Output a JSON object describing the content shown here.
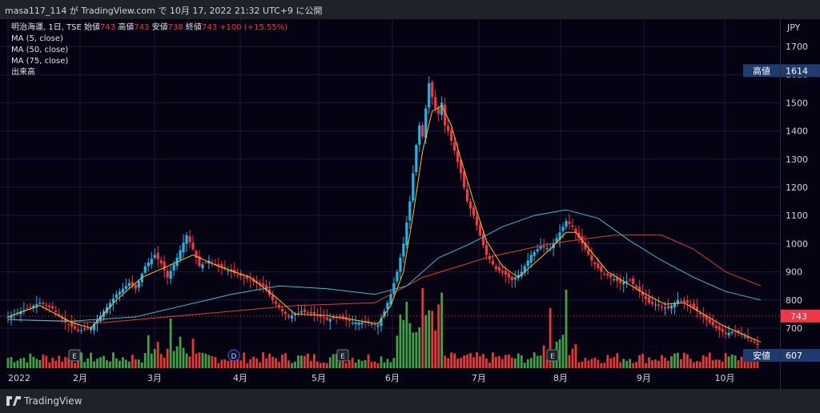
{
  "header": {
    "publish_line": "masa117_114 が TradingView.com で 10月 17, 2022 21:32 UTC+9 に公開"
  },
  "legend": {
    "symbol": "明治海運, 1日, TSE",
    "open_label": "始値",
    "open_value": "743",
    "high_label": "高値",
    "high_value": "743",
    "low_label": "安値",
    "low_value": "738",
    "close_label": "終値",
    "close_value": "743",
    "change": "+100 (+15.55%)",
    "ma5": "MA (5, close)",
    "ma50": "MA (50, close)",
    "ma75": "MA (75, close)",
    "volume": "出来高"
  },
  "footer": {
    "brand": "TradingView"
  },
  "colors": {
    "up": "#26a69a",
    "up_candle": "#22b5e6",
    "down": "#f23645",
    "ma5": "#f5c518",
    "ma50": "#2ec4d6",
    "ma75": "#e53935",
    "vol_up": "#43a047",
    "vol_down": "#e53935"
  },
  "chart_data": {
    "type": "candlestick",
    "currency": "JPY",
    "ylim": [
      600,
      1750
    ],
    "y_ticks": [
      "1700",
      "1600",
      "1500",
      "1400",
      "1300",
      "1200",
      "1100",
      "1000",
      "900",
      "800",
      "700"
    ],
    "x_ticks": [
      "2022",
      "2月",
      "3月",
      "4月",
      "5月",
      "6月",
      "7月",
      "8月",
      "9月",
      "10月"
    ],
    "markers": [
      "E",
      "D",
      "E",
      "E"
    ],
    "high_label": "高値",
    "high_value": "1614",
    "low_label": "安値",
    "low_value": "607",
    "last_price": "743",
    "price_path": [
      [
        0,
        740
      ],
      [
        6,
        770
      ],
      [
        10,
        790
      ],
      [
        14,
        770
      ],
      [
        18,
        720
      ],
      [
        22,
        690
      ],
      [
        26,
        700
      ],
      [
        30,
        760
      ],
      [
        34,
        820
      ],
      [
        38,
        860
      ],
      [
        40,
        840
      ],
      [
        43,
        920
      ],
      [
        46,
        960
      ],
      [
        48,
        930
      ],
      [
        50,
        880
      ],
      [
        53,
        950
      ],
      [
        56,
        1030
      ],
      [
        58,
        980
      ],
      [
        60,
        920
      ],
      [
        63,
        940
      ],
      [
        66,
        920
      ],
      [
        70,
        900
      ],
      [
        74,
        880
      ],
      [
        78,
        860
      ],
      [
        80,
        850
      ],
      [
        83,
        800
      ],
      [
        86,
        760
      ],
      [
        88,
        740
      ],
      [
        92,
        760
      ],
      [
        96,
        750
      ],
      [
        100,
        730
      ],
      [
        104,
        740
      ],
      [
        108,
        720
      ],
      [
        112,
        720
      ],
      [
        116,
        710
      ],
      [
        118,
        760
      ],
      [
        120,
        820
      ],
      [
        122,
        900
      ],
      [
        124,
        1000
      ],
      [
        126,
        1150
      ],
      [
        127,
        1250
      ],
      [
        128,
        1350
      ],
      [
        129,
        1420
      ],
      [
        130,
        1380
      ],
      [
        131,
        1480
      ],
      [
        132,
        1570
      ],
      [
        133,
        1520
      ],
      [
        134,
        1480
      ],
      [
        135,
        1460
      ],
      [
        136,
        1500
      ],
      [
        137,
        1420
      ],
      [
        138,
        1400
      ],
      [
        140,
        1330
      ],
      [
        142,
        1250
      ],
      [
        144,
        1150
      ],
      [
        146,
        1100
      ],
      [
        148,
        1030
      ],
      [
        150,
        960
      ],
      [
        153,
        910
      ],
      [
        156,
        890
      ],
      [
        158,
        870
      ],
      [
        161,
        900
      ],
      [
        164,
        960
      ],
      [
        167,
        990
      ],
      [
        170,
        980
      ],
      [
        173,
        1040
      ],
      [
        175,
        1080
      ],
      [
        177,
        1060
      ],
      [
        180,
        1000
      ],
      [
        183,
        940
      ],
      [
        186,
        900
      ],
      [
        189,
        880
      ],
      [
        192,
        860
      ],
      [
        195,
        870
      ],
      [
        198,
        830
      ],
      [
        201,
        790
      ],
      [
        204,
        780
      ],
      [
        207,
        770
      ],
      [
        210,
        800
      ],
      [
        213,
        790
      ],
      [
        216,
        760
      ],
      [
        219,
        730
      ],
      [
        222,
        700
      ],
      [
        225,
        680
      ],
      [
        228,
        690
      ],
      [
        231,
        670
      ],
      [
        234,
        650
      ],
      [
        235,
        640
      ],
      [
        236,
        743
      ]
    ],
    "ma5": [
      [
        0,
        740
      ],
      [
        10,
        780
      ],
      [
        20,
        720
      ],
      [
        26,
        700
      ],
      [
        34,
        800
      ],
      [
        42,
        880
      ],
      [
        50,
        920
      ],
      [
        58,
        960
      ],
      [
        66,
        920
      ],
      [
        76,
        880
      ],
      [
        84,
        810
      ],
      [
        90,
        750
      ],
      [
        100,
        745
      ],
      [
        108,
        730
      ],
      [
        116,
        715
      ],
      [
        120,
        780
      ],
      [
        124,
        900
      ],
      [
        127,
        1100
      ],
      [
        130,
        1330
      ],
      [
        133,
        1470
      ],
      [
        136,
        1490
      ],
      [
        139,
        1420
      ],
      [
        142,
        1300
      ],
      [
        146,
        1150
      ],
      [
        150,
        1010
      ],
      [
        155,
        920
      ],
      [
        160,
        880
      ],
      [
        164,
        920
      ],
      [
        170,
        980
      ],
      [
        175,
        1040
      ],
      [
        178,
        1040
      ],
      [
        183,
        970
      ],
      [
        188,
        900
      ],
      [
        194,
        860
      ],
      [
        200,
        820
      ],
      [
        206,
        785
      ],
      [
        212,
        790
      ],
      [
        218,
        750
      ],
      [
        224,
        710
      ],
      [
        230,
        680
      ],
      [
        236,
        650
      ]
    ],
    "ma50": [
      [
        0,
        730
      ],
      [
        20,
        725
      ],
      [
        40,
        740
      ],
      [
        55,
        780
      ],
      [
        70,
        820
      ],
      [
        85,
        850
      ],
      [
        100,
        840
      ],
      [
        115,
        820
      ],
      [
        125,
        850
      ],
      [
        135,
        950
      ],
      [
        145,
        1000
      ],
      [
        155,
        1060
      ],
      [
        165,
        1100
      ],
      [
        175,
        1120
      ],
      [
        185,
        1090
      ],
      [
        195,
        1010
      ],
      [
        205,
        940
      ],
      [
        215,
        880
      ],
      [
        225,
        830
      ],
      [
        236,
        800
      ]
    ],
    "ma75": [
      [
        0,
        730
      ],
      [
        30,
        720
      ],
      [
        60,
        750
      ],
      [
        90,
        780
      ],
      [
        115,
        790
      ],
      [
        130,
        880
      ],
      [
        150,
        950
      ],
      [
        170,
        1000
      ],
      [
        190,
        1030
      ],
      [
        205,
        1030
      ],
      [
        215,
        980
      ],
      [
        225,
        900
      ],
      [
        236,
        850
      ]
    ],
    "volume_bars": 236
  }
}
